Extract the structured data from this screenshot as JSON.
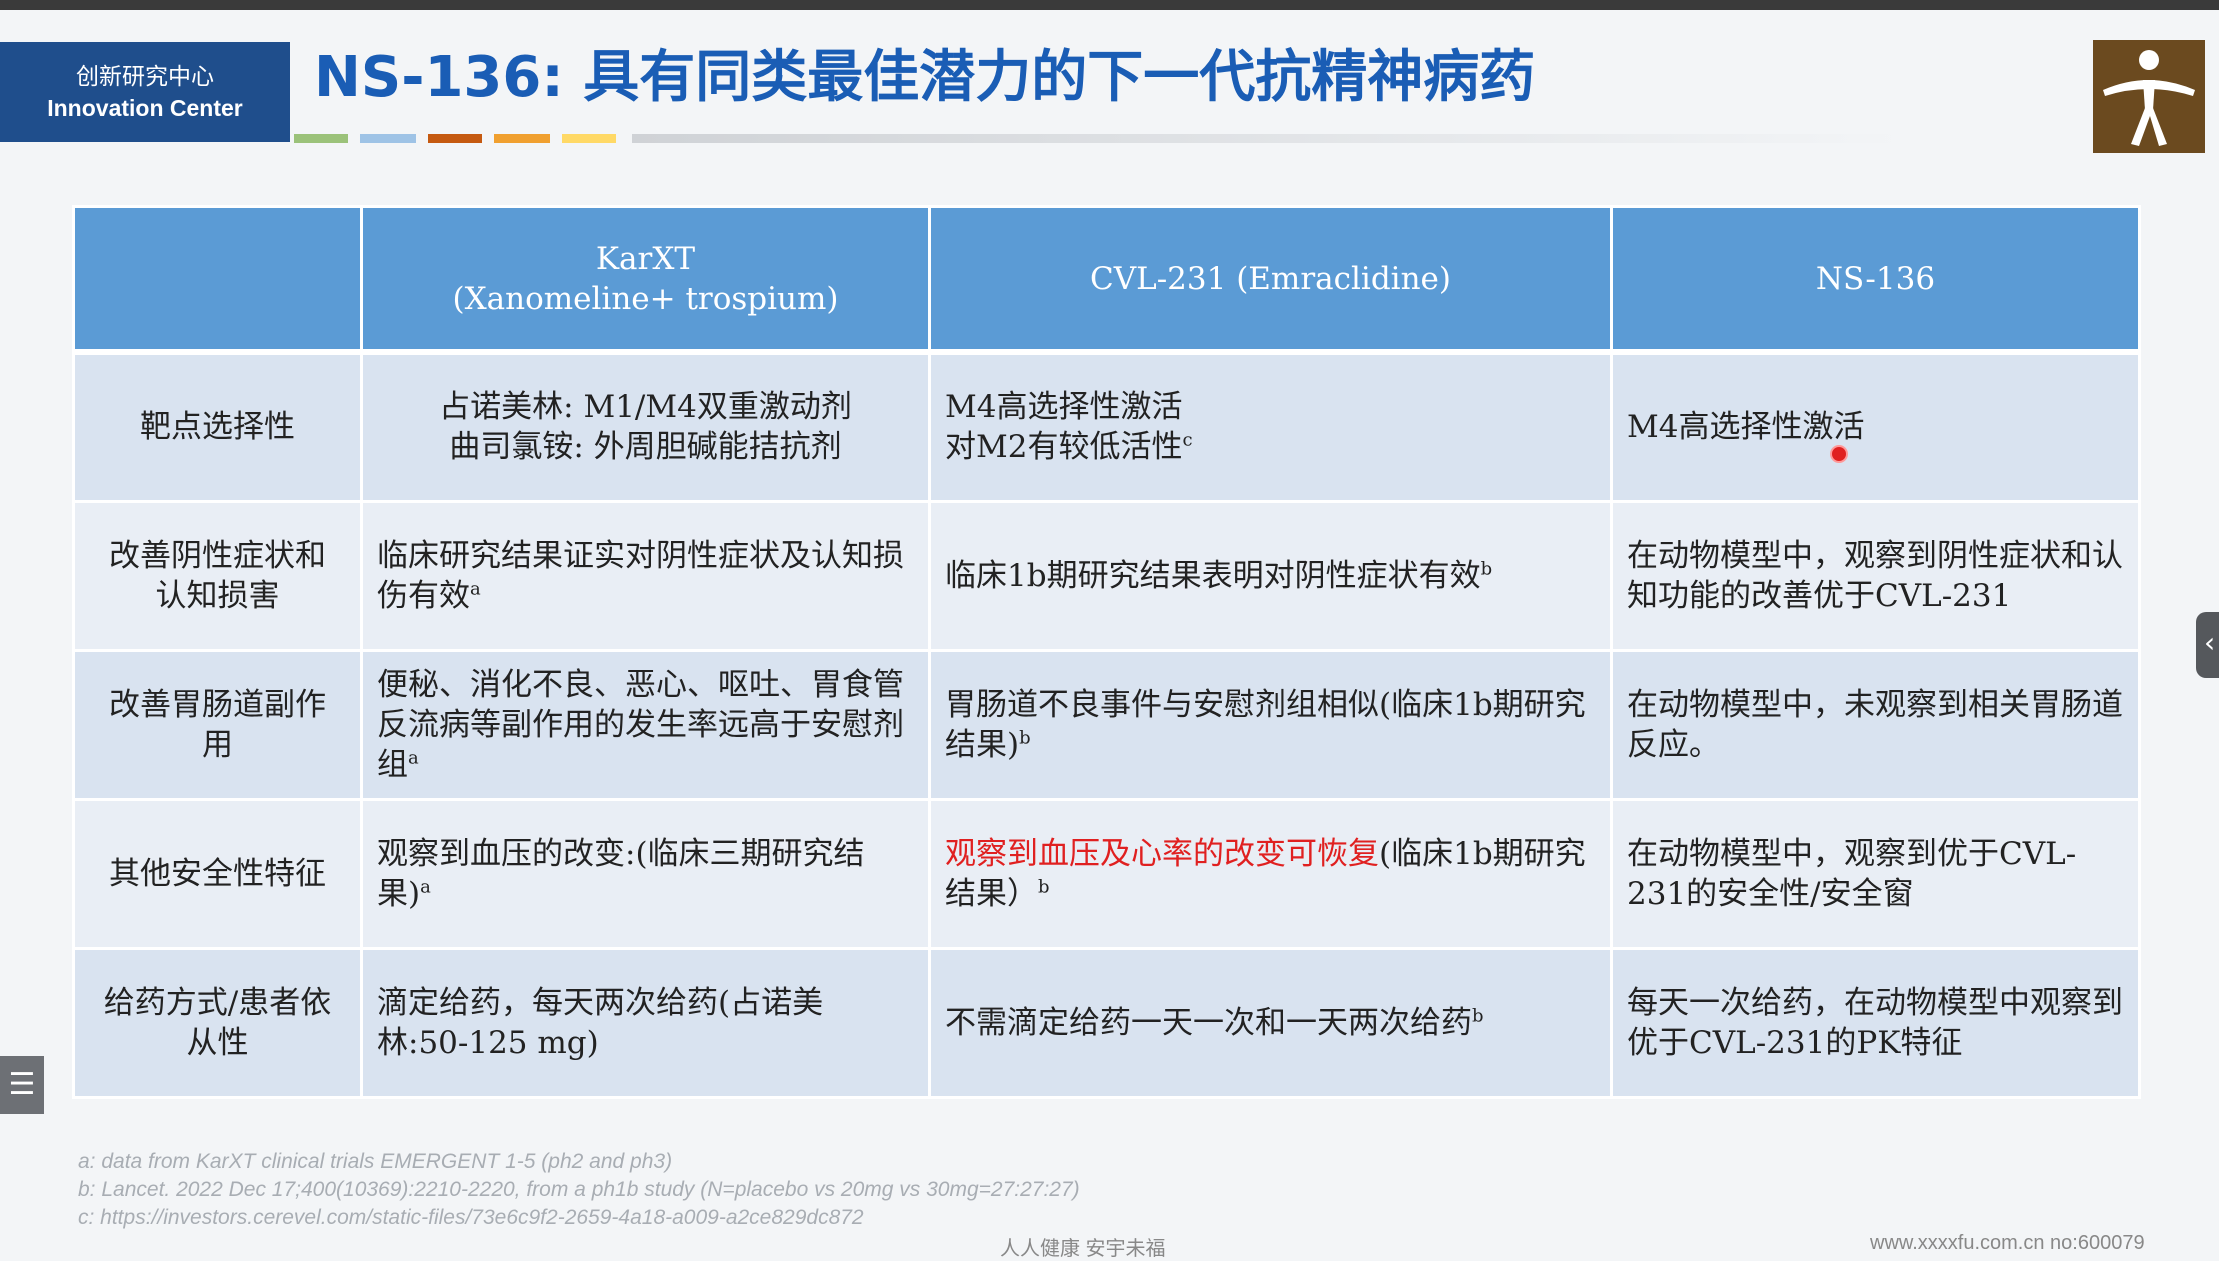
{
  "header": {
    "badge_cn": "创新研究中心",
    "badge_en": "Innovation Center",
    "title": "NS-136: 具有同类最佳潜力的下一代抗精神病药",
    "stripe_colors": [
      "#9bc27a",
      "#9ec3e6",
      "#c55a11",
      "#f0a030",
      "#ffd966",
      "#d9d9d9"
    ]
  },
  "table": {
    "headers": [
      "",
      "KarXT",
      "(Xanomeline+ trospium)",
      "CVL-231 (Emraclidine)",
      "NS-136"
    ],
    "rows": [
      {
        "label": "靶点选择性",
        "karxt_1": "占诺美林: M1/M4双重激动剂",
        "karxt_2": "曲司氯铵: 外周胆碱能拮抗剂",
        "cvl_1": "M4高选择性激活",
        "cvl_2": "对M2有较低活性",
        "cvl_sup": "c",
        "ns": "M4高选择性激活"
      },
      {
        "label_1": "改善阴性症状和",
        "label_2": "认知损害",
        "karxt": "临床研究结果证实对阴性症状及认知损伤有效",
        "karxt_sup": "a",
        "cvl": "临床1b期研究结果表明对阴性症状有效",
        "cvl_sup": "b",
        "ns": "在动物模型中，观察到阴性症状和认知功能的改善优于CVL-231"
      },
      {
        "label_1": "改善胃肠道副作",
        "label_2": "用",
        "karxt": "便秘、消化不良、恶心、呕吐、胃食管反流病等副作用的发生率远高于安慰剂组",
        "karxt_sup": "a",
        "cvl": "胃肠道不良事件与安慰剂组相似(临床1b期研究结果)",
        "cvl_sup": "b",
        "ns": "在动物模型中，未观察到相关胃肠道反应。"
      },
      {
        "label": "其他安全性特征",
        "karxt": "观察到血压的改变:(临床三期研究结果)",
        "karxt_sup": "a",
        "cvl_red": "观察到血压及心率的改变可恢复",
        "cvl": "(临床1b期研究结果）",
        "cvl_sup": "b",
        "ns": "在动物模型中，观察到优于CVL-231的安全性/安全窗"
      },
      {
        "label_1": "给药方式/患者依",
        "label_2": "从性",
        "karxt": "滴定给药，每天两次给药(占诺美林:50-125 mg)",
        "cvl": "不需滴定给药一天一次和一天两次给药",
        "cvl_sup": "b",
        "ns": "每天一次给药，在动物模型中观察到优于CVL-231的PK特征"
      }
    ]
  },
  "footnotes": [
    "a: data from KarXT clinical trials EMERGENT 1-5 (ph2 and ph3)",
    "b: Lancet. 2022 Dec 17;400(10369):2210-2220, from a ph1b study (N=placebo vs 20mg vs 30mg=27:27:27)",
    "c: https://investors.cerevel.com/static-files/73e6c9f2-2659-4a18-a009-a2ce829dc872"
  ],
  "bottom": {
    "center": "人人健康 安宇未福",
    "right": "www.xxxxfu.com.cn  no:600079"
  },
  "icons": {
    "side_tab": "‹",
    "menu": "☰"
  }
}
